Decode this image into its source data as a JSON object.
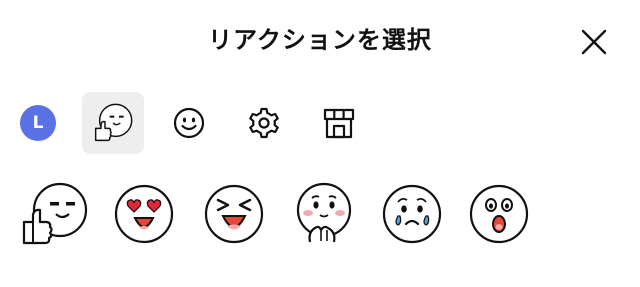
{
  "header": {
    "title": "リアクションを選択",
    "close_icon": "close-icon"
  },
  "tabs": [
    {
      "name": "user-avatar",
      "letter": "L",
      "color": "#5b71e6"
    },
    {
      "name": "brown-thumbs-up-sticker-icon",
      "selected": true
    },
    {
      "name": "smiley-icon"
    },
    {
      "name": "gear-icon"
    },
    {
      "name": "shop-icon"
    }
  ],
  "stickers": [
    {
      "name": "sticker-thumbs-up-icon"
    },
    {
      "name": "sticker-heart-eyes-icon"
    },
    {
      "name": "sticker-laughing-icon"
    },
    {
      "name": "sticker-shy-icon"
    },
    {
      "name": "sticker-crying-icon"
    },
    {
      "name": "sticker-surprised-icon"
    }
  ]
}
